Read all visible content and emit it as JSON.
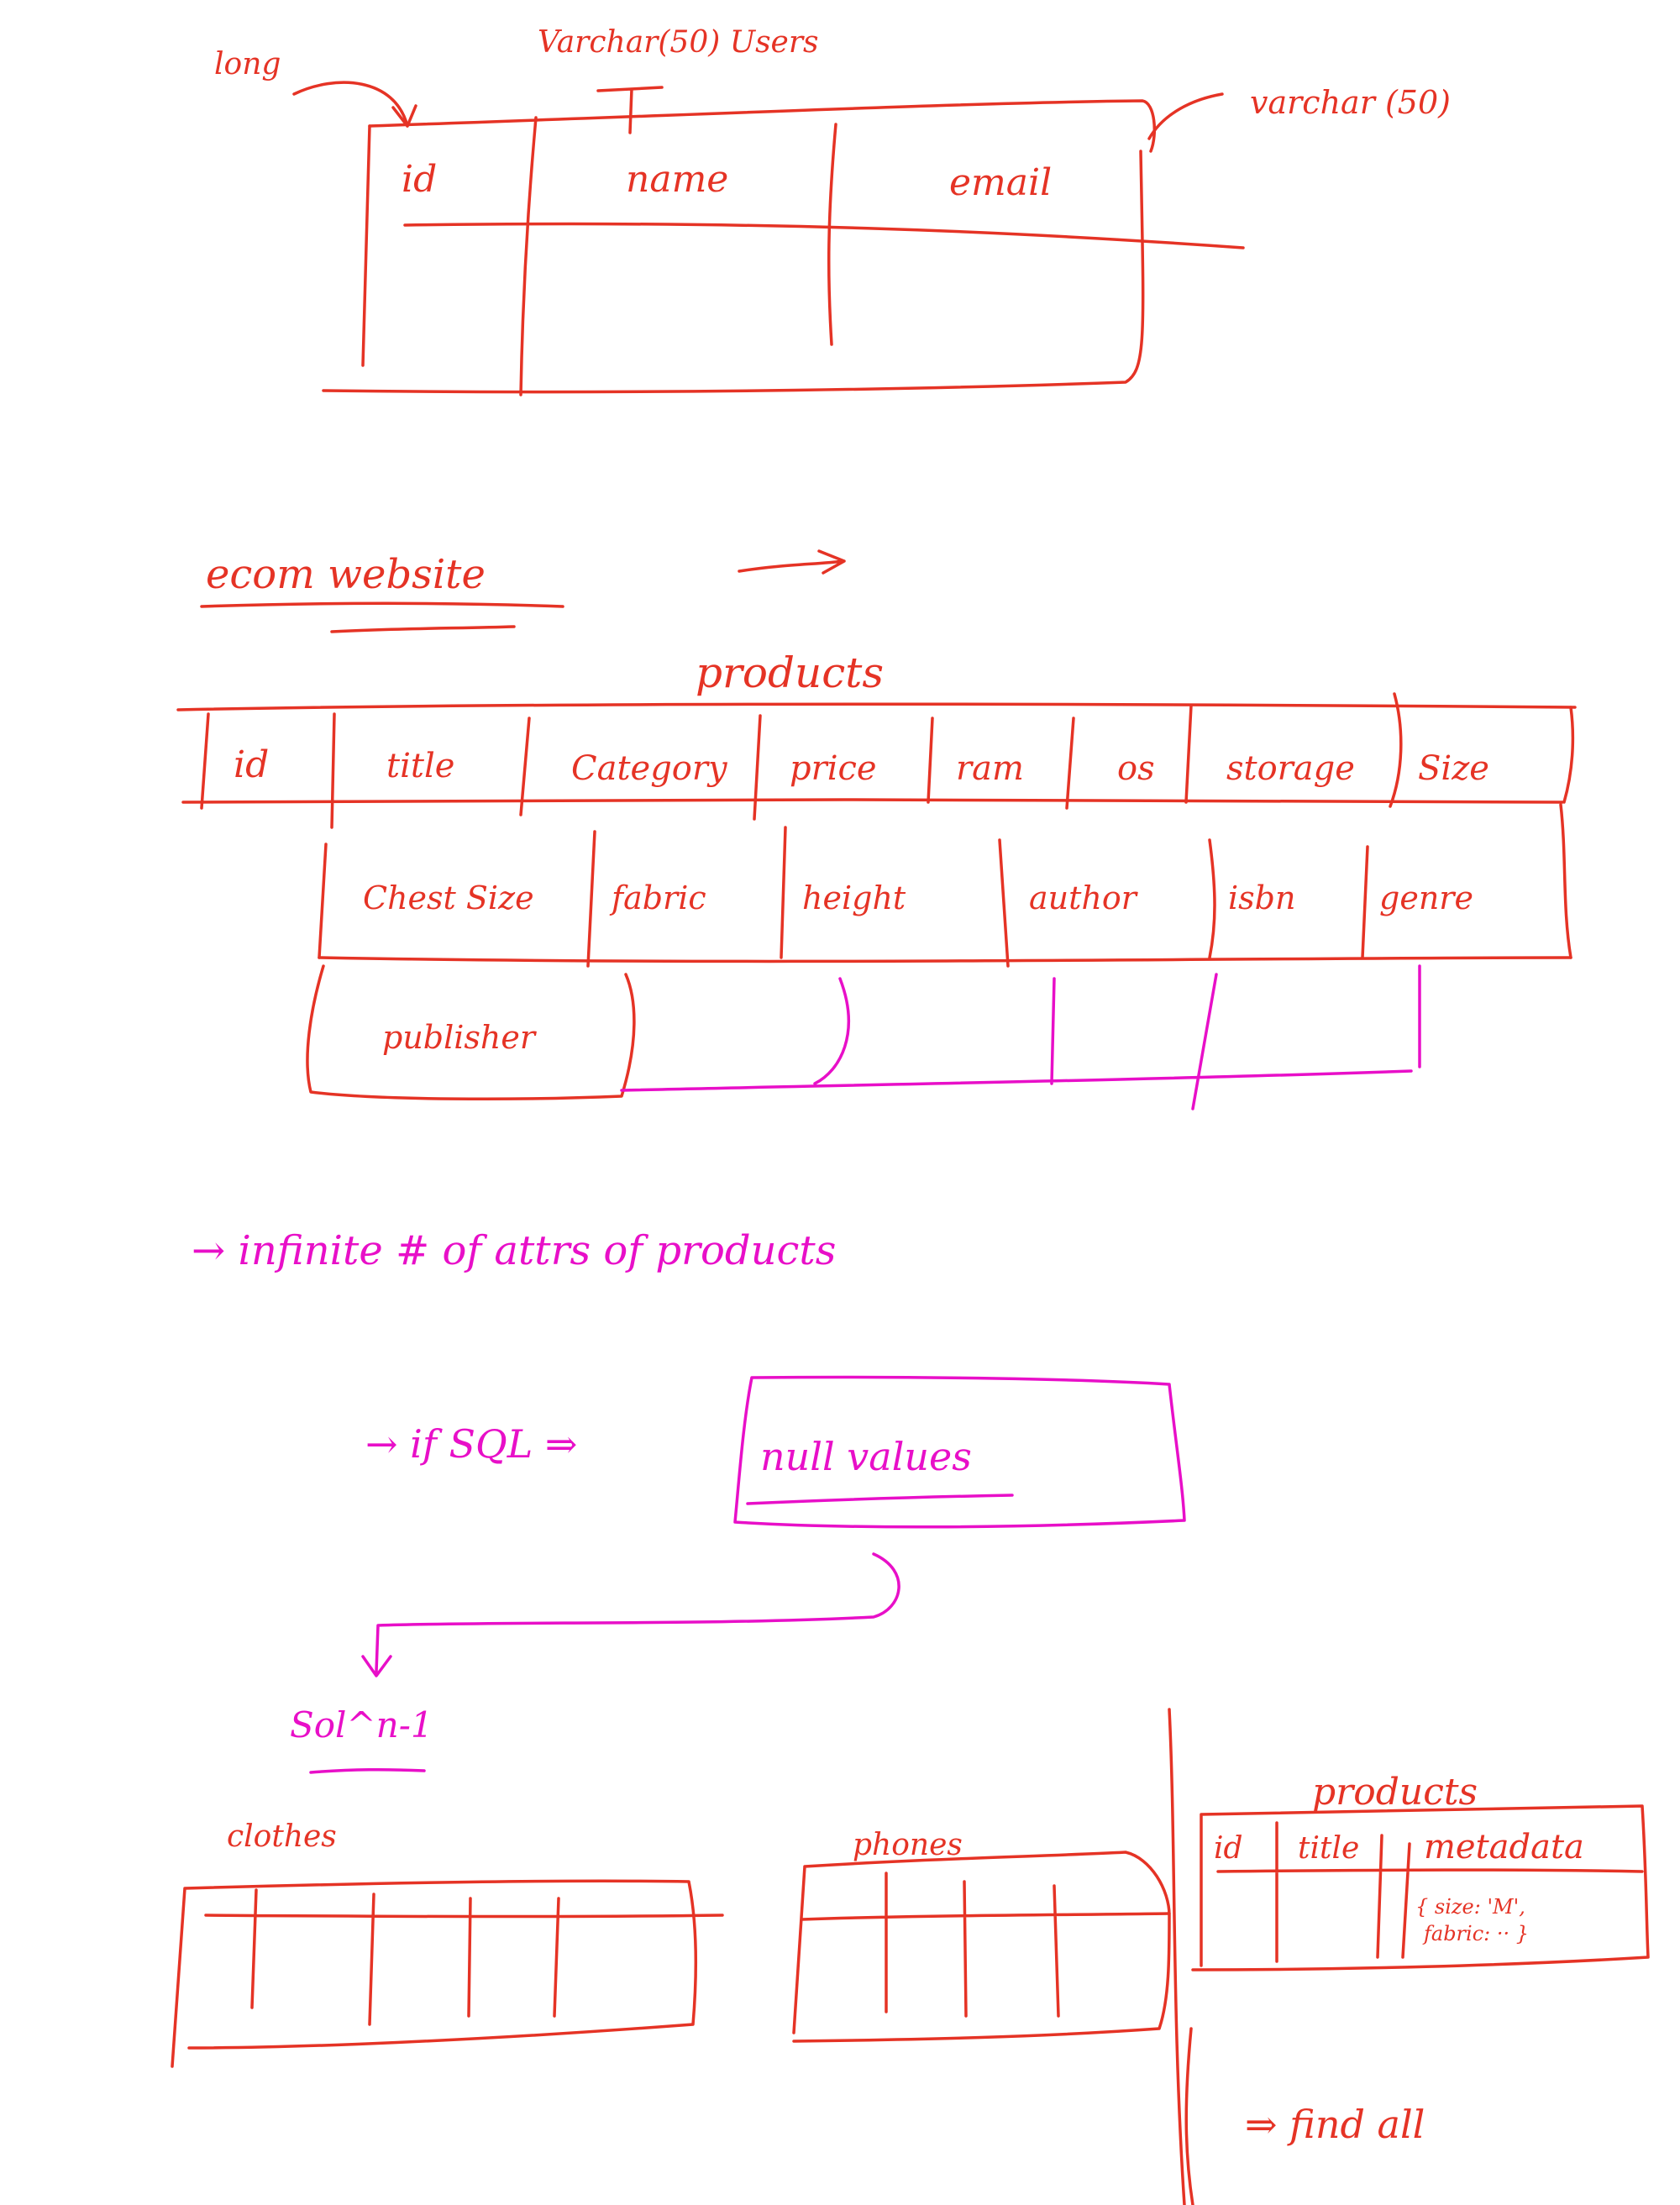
{
  "colors": {
    "red_ink": "#e53325",
    "magenta_ink": "#e80fc8",
    "background": "#ffffff"
  },
  "users_table": {
    "note_left": "long",
    "note_top": "Varchar(50) Users",
    "note_right": "varchar (50)",
    "columns": [
      "id",
      "name",
      "email"
    ]
  },
  "ecom": {
    "heading": "ecom website",
    "table_title": "products",
    "row1": [
      "id",
      "title",
      "Category",
      "price",
      "ram",
      "os",
      "storage",
      "Size"
    ],
    "row2": [
      "Chest Size",
      "fabric",
      "height",
      "author",
      "isbn",
      "genre"
    ],
    "row3": [
      "publisher"
    ]
  },
  "notes": {
    "infinite": "→ infinite # of attrs of products",
    "sql_prefix": "→ if SQL ⇒",
    "null_values": "null values",
    "sol1": "Sol^n-1"
  },
  "bottom": {
    "clothes_label": "clothes",
    "phones_label": "phones",
    "products_title": "products",
    "products_columns": [
      "id",
      "title",
      "metadata"
    ],
    "metadata_example_line1": "{ size: 'M',",
    "metadata_example_line2": "fabric: ·· }",
    "find_all": "⇒ find all"
  }
}
